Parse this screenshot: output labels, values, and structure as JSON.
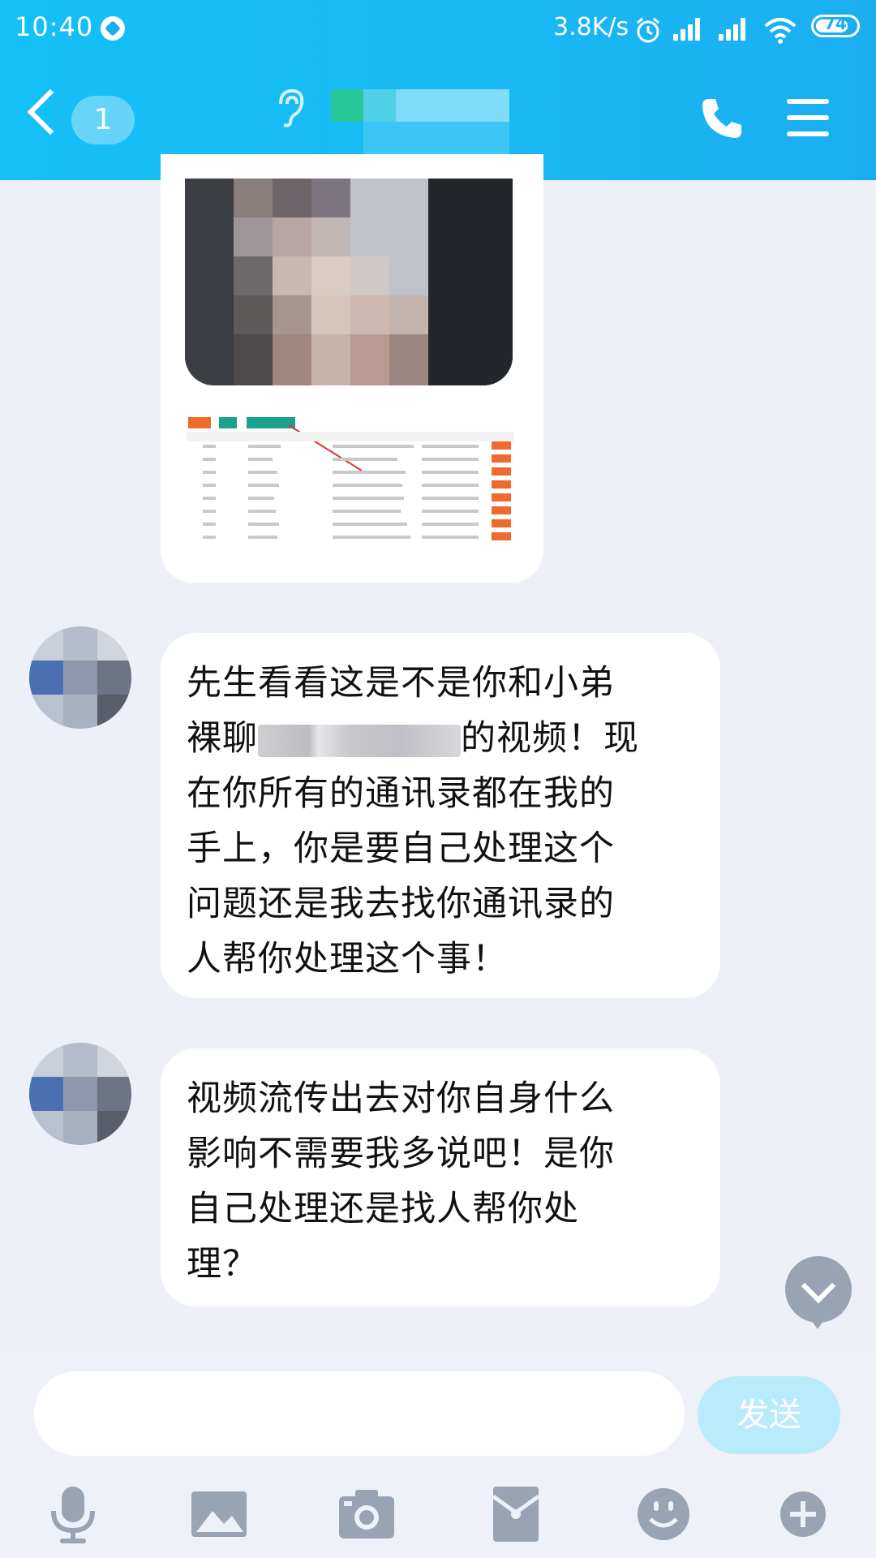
{
  "status_bar": {
    "time": "10:40",
    "net_speed": "3.8K/s",
    "battery": "74"
  },
  "header": {
    "unread_count": "1",
    "contact_name": ""
  },
  "messages": [
    {
      "lines": [
        "先生看看这是不是你和小弟",
        "裸聊",
        "的视频！现",
        "在你所有的通讯录都在我的",
        "手上，你是要自己处理这个",
        "问题还是我去找你通讯录的",
        "人帮你处理这个事！"
      ]
    },
    {
      "lines": [
        "视频流传出去对你自身什么",
        "影响不需要我多说吧！是你",
        "自己处理还是找人帮你处",
        "理？"
      ]
    }
  ],
  "composer": {
    "send_label": "发送",
    "input_value": ""
  },
  "colors": {
    "header": "#19b9f4",
    "background": "#edf0f6",
    "send_button": "#b9ecfb",
    "icon_gray": "#9aa3b3"
  },
  "icons": [
    "back-icon",
    "ear-icon",
    "phone-icon",
    "menu-icon",
    "microphone-icon",
    "image-icon",
    "camera-icon",
    "red-packet-icon",
    "emoji-icon",
    "plus-icon"
  ]
}
